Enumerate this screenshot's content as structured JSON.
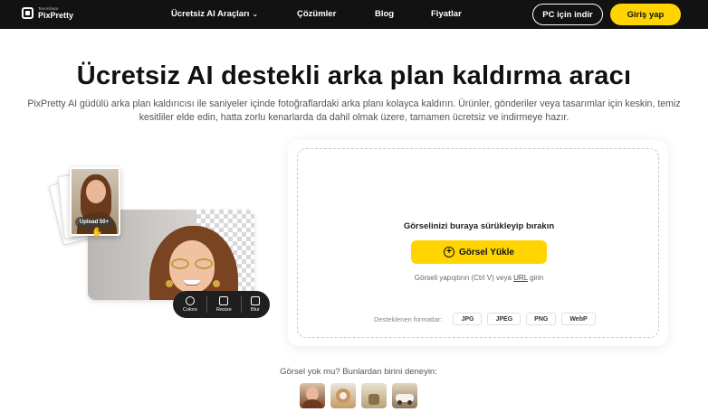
{
  "nav": {
    "brand_small": "Tenorshare",
    "brand_name": "PixPretty",
    "items": [
      {
        "label": "Ücretsiz AI Araçları"
      },
      {
        "label": "Çözümler"
      },
      {
        "label": "Blog"
      },
      {
        "label": "Fiyatlar"
      }
    ],
    "pc_button": "PC için indir",
    "login_button": "Giriş yap"
  },
  "hero": {
    "title_highlight": "Ücretsiz",
    "title_rest": " AI destekli arka plan kaldırma aracı",
    "subtitle": "PixPretty AI güdülü arka plan kaldırıcısı ile saniyeler içinde fotoğraflardaki arka planı kolayca kaldırın. Ürünler, gönderiler veya tasarımlar için keskin, temiz kesitliler elde edin, hatta zorlu kenarlarda da dahil olmak üzere, tamamen ücretsiz ve indirmeye hazır."
  },
  "illustration": {
    "upload_pill": "Upload 50+",
    "tools": [
      {
        "label": "Colors",
        "icon": "colors-icon"
      },
      {
        "label": "Resize",
        "icon": "resize-icon"
      },
      {
        "label": "Blur",
        "icon": "blur-icon"
      }
    ]
  },
  "upload": {
    "drop_text": "Görselinizi buraya sürükleyip bırakın",
    "button_label": "Görsel Yükle",
    "paste_prefix": "Görseli yapıştırın (Ctrl V) veya ",
    "paste_url": "URL",
    "paste_suffix": " girin",
    "formats_label": "Desteklenen formatlar:",
    "formats": [
      "JPG",
      "JPEG",
      "PNG",
      "WebP"
    ]
  },
  "samples": {
    "title": "Görsel yok mu? Bunlardan birini deneyin:"
  },
  "colors": {
    "nav_bg": "#121212",
    "accent": "#ffd400"
  }
}
